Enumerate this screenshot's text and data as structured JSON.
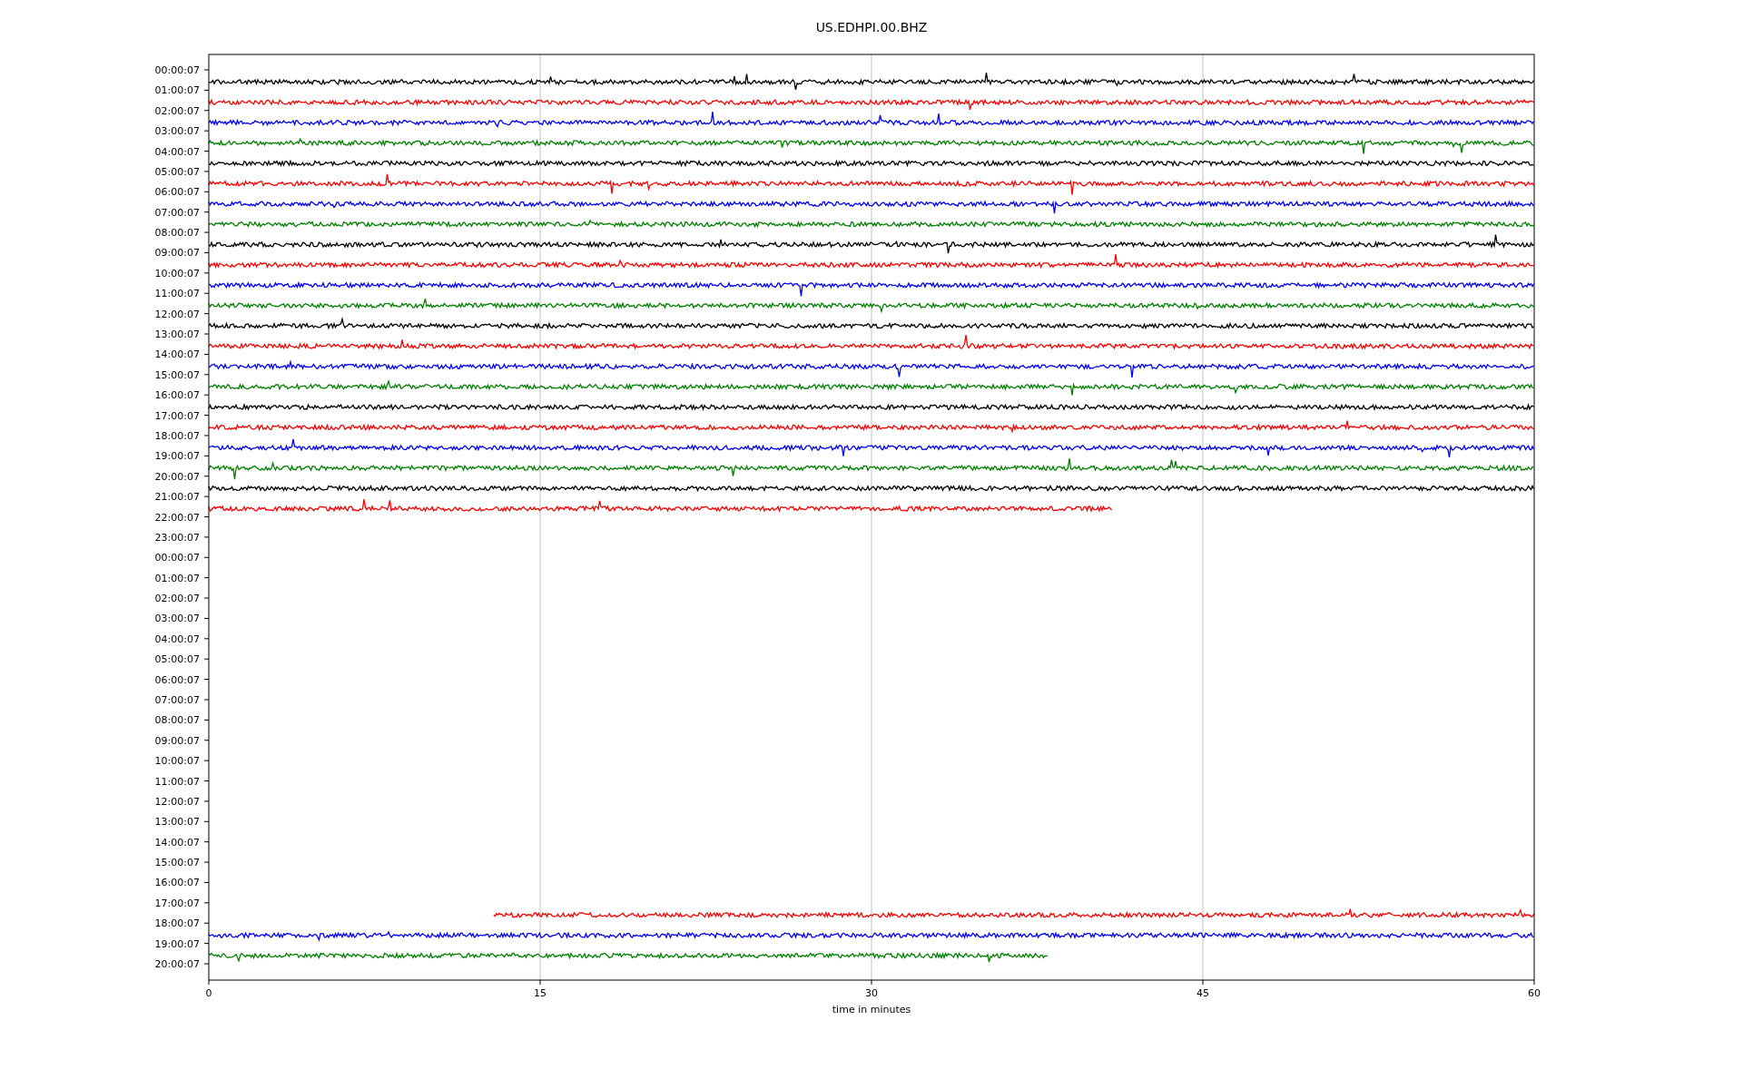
{
  "title": "US.EDHPI.00.BHZ",
  "xlabel": "time in minutes",
  "xticks": [
    "0",
    "15",
    "30",
    "45",
    "60"
  ],
  "rows": [
    {
      "label": "00:00:07"
    },
    {
      "label": "01:00:07",
      "trace": {
        "color": "#000000",
        "kind": "from-start",
        "level": 1
      }
    },
    {
      "label": "02:00:07",
      "trace": {
        "color": "#ff0000",
        "kind": "from-start",
        "level": 1
      }
    },
    {
      "label": "03:00:07",
      "trace": {
        "color": "#0000ff",
        "kind": "from-start",
        "level": 1
      }
    },
    {
      "label": "04:00:07",
      "trace": {
        "color": "#008000",
        "kind": "from-start",
        "level": 1
      }
    },
    {
      "label": "05:00:07",
      "trace": {
        "color": "#000000",
        "kind": "from-start",
        "level": 1
      }
    },
    {
      "label": "06:00:07",
      "trace": {
        "color": "#ff0000",
        "kind": "from-start",
        "level": 1
      }
    },
    {
      "label": "07:00:07",
      "trace": {
        "color": "#0000ff",
        "kind": "from-start",
        "level": 1
      }
    },
    {
      "label": "08:00:07",
      "trace": {
        "color": "#008000",
        "kind": "from-start",
        "level": 1
      }
    },
    {
      "label": "09:00:07",
      "trace": {
        "color": "#000000",
        "kind": "from-start",
        "level": 1
      }
    },
    {
      "label": "10:00:07",
      "trace": {
        "color": "#ff0000",
        "kind": "from-start",
        "level": 1
      }
    },
    {
      "label": "11:00:07",
      "trace": {
        "color": "#0000ff",
        "kind": "from-start",
        "level": 1
      }
    },
    {
      "label": "12:00:07",
      "trace": {
        "color": "#008000",
        "kind": "from-start",
        "level": 1
      }
    },
    {
      "label": "13:00:07",
      "trace": {
        "color": "#000000",
        "kind": "from-start",
        "level": 1
      }
    },
    {
      "label": "14:00:07",
      "trace": {
        "color": "#ff0000",
        "kind": "from-start",
        "level": 1
      }
    },
    {
      "label": "15:00:07",
      "trace": {
        "color": "#0000ff",
        "kind": "from-start",
        "level": 1
      }
    },
    {
      "label": "16:00:07",
      "trace": {
        "color": "#008000",
        "kind": "from-start",
        "level": 1
      }
    },
    {
      "label": "17:00:07",
      "trace": {
        "color": "#000000",
        "kind": "from-start",
        "level": 1
      }
    },
    {
      "label": "18:00:07",
      "trace": {
        "color": "#ff0000",
        "kind": "from-start",
        "level": 1
      }
    },
    {
      "label": "19:00:07",
      "trace": {
        "color": "#0000ff",
        "kind": "from-start",
        "level": 1
      }
    },
    {
      "label": "20:00:07",
      "trace": {
        "color": "#008000",
        "kind": "from-start",
        "level": 1
      }
    },
    {
      "label": "21:00:07",
      "trace": {
        "color": "#000000",
        "kind": "from-start",
        "level": 1
      }
    },
    {
      "label": "22:00:07",
      "trace": {
        "color": "#ff0000",
        "kind": "from-start",
        "level": 0.682
      }
    },
    {
      "label": "23:00:07"
    },
    {
      "label": "00:00:07"
    },
    {
      "label": "01:00:07"
    },
    {
      "label": "02:00:07"
    },
    {
      "label": "03:00:07"
    },
    {
      "label": "04:00:07"
    },
    {
      "label": "05:00:07"
    },
    {
      "label": "06:00:07"
    },
    {
      "label": "07:00:07"
    },
    {
      "label": "08:00:07"
    },
    {
      "label": "09:00:07"
    },
    {
      "label": "10:00:07"
    },
    {
      "label": "11:00:07"
    },
    {
      "label": "12:00:07"
    },
    {
      "label": "13:00:07"
    },
    {
      "label": "14:00:07"
    },
    {
      "label": "15:00:07"
    },
    {
      "label": "16:00:07"
    },
    {
      "label": "17:00:07"
    },
    {
      "label": "18:00:07",
      "trace": {
        "color": "#ff0000",
        "kind": "to-end",
        "level": 0.785
      }
    },
    {
      "label": "19:00:07",
      "trace": {
        "color": "#0000ff",
        "kind": "from-start",
        "level": 1
      }
    },
    {
      "label": "20:00:07",
      "trace": {
        "color": "#008000",
        "kind": "from-start",
        "level": 0.633
      }
    }
  ]
}
